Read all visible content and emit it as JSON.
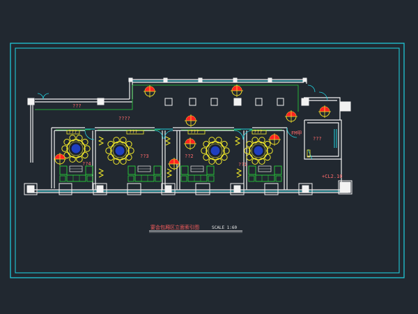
{
  "drawing": {
    "title": "宴会包厢区立面索引图",
    "scale": "SCALE 1:60",
    "colors": {
      "background": "#212830",
      "frame": "#21c7d6",
      "walls": "#f2f2f2",
      "glass": "#22d3e0",
      "furniture": "#27d13a",
      "table": "#f4ec2a",
      "table_center": "#1f3fbf",
      "marker_red": "#ff2222",
      "marker_yellow": "#f2e02a",
      "text_red": "#ff6b6b"
    }
  },
  "labels": {
    "corridor": "???",
    "foyer": "????",
    "room_1": "??4",
    "room_2": "??3",
    "room_3": "??2",
    "room_4": "??1",
    "right_room": "???",
    "fire_exit": "FM甲",
    "elevation_ref": "+CL2.10",
    "sign_1": "???",
    "sign_2": "???",
    "sign_3": "???",
    "sign_4": "???"
  },
  "icons": [
    "elevation-marker-icon",
    "round-table-icon",
    "sofa-set-icon",
    "door-swing-icon",
    "column-icon"
  ]
}
